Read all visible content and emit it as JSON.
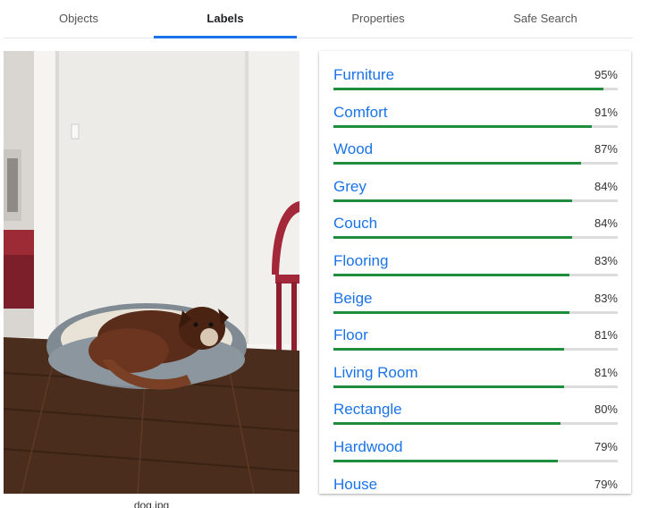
{
  "tabs": [
    {
      "label": "Objects",
      "active": false
    },
    {
      "label": "Labels",
      "active": true
    },
    {
      "label": "Properties",
      "active": false
    },
    {
      "label": "Safe Search",
      "active": false
    }
  ],
  "image": {
    "filename": "dog.jpg"
  },
  "labels": [
    {
      "name": "Furniture",
      "percent": "95%",
      "score": 0.95
    },
    {
      "name": "Comfort",
      "percent": "91%",
      "score": 0.91
    },
    {
      "name": "Wood",
      "percent": "87%",
      "score": 0.87
    },
    {
      "name": "Grey",
      "percent": "84%",
      "score": 0.84
    },
    {
      "name": "Couch",
      "percent": "84%",
      "score": 0.84
    },
    {
      "name": "Flooring",
      "percent": "83%",
      "score": 0.83
    },
    {
      "name": "Beige",
      "percent": "83%",
      "score": 0.83
    },
    {
      "name": "Floor",
      "percent": "81%",
      "score": 0.81
    },
    {
      "name": "Living Room",
      "percent": "81%",
      "score": 0.81
    },
    {
      "name": "Rectangle",
      "percent": "80%",
      "score": 0.8
    },
    {
      "name": "Hardwood",
      "percent": "79%",
      "score": 0.79
    },
    {
      "name": "House",
      "percent": "79%",
      "score": 0.79
    }
  ],
  "colors": {
    "accent": "#1a73e8",
    "bar_fill": "#1e8e3e",
    "bar_track": "#dcdcdc"
  }
}
